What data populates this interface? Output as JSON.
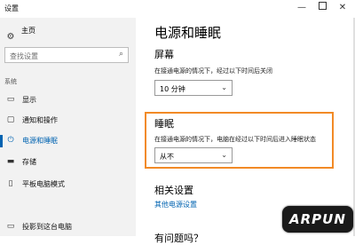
{
  "window": {
    "title": "设置",
    "minimize": "—",
    "close": "✕"
  },
  "sidebar": {
    "home": {
      "label": "主页",
      "icon": "gear-icon"
    },
    "search": {
      "placeholder": "查找设置",
      "icon": "search-icon"
    },
    "section_label": "系统",
    "items": [
      {
        "label": "显示",
        "icon": "display-icon",
        "active": false
      },
      {
        "label": "通知和操作",
        "icon": "notification-icon",
        "active": false
      },
      {
        "label": "电源和睡眠",
        "icon": "power-icon",
        "active": true
      },
      {
        "label": "存储",
        "icon": "storage-icon",
        "active": false
      },
      {
        "label": "平板电脑模式",
        "icon": "tablet-icon",
        "active": false
      },
      {
        "label": "投影到这台电脑",
        "icon": "projection-icon",
        "active": false
      }
    ]
  },
  "main": {
    "title": "电源和睡眠",
    "screen": {
      "heading": "屏幕",
      "description": "在接通电源的情况下，经过以下时间后关闭",
      "value": "10 分钟"
    },
    "sleep": {
      "heading": "睡眠",
      "description": "在接通电源的情况下，电脑在经过以下时间后进入睡眠状态",
      "value": "从不"
    },
    "related": {
      "heading": "相关设置",
      "link": "其他电源设置"
    },
    "cutoff_heading": "有问题吗？"
  },
  "highlight_color": "#f28a26",
  "accent_color": "#0063b1",
  "watermark": {
    "text": "ARPUN"
  }
}
